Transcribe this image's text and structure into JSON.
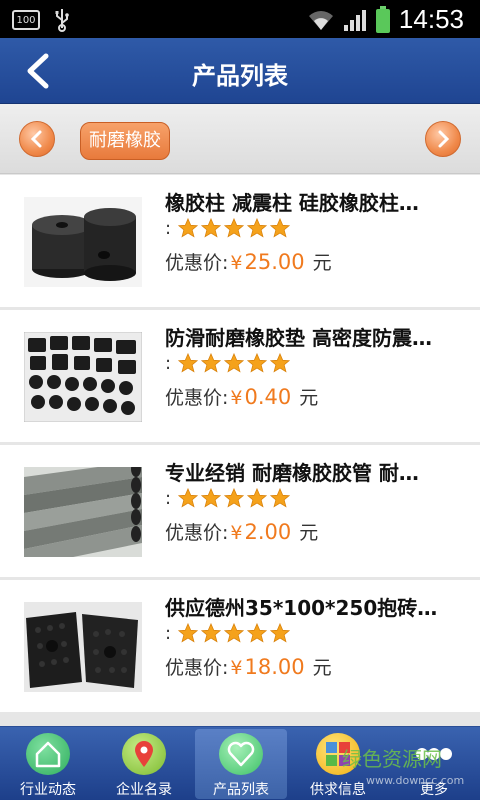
{
  "status_bar": {
    "battery_small": "100",
    "time": "14:53"
  },
  "header": {
    "title": "产品列表"
  },
  "category": {
    "active": "耐磨橡胶"
  },
  "products": [
    {
      "title": "橡胶柱 减震柱 硅胶橡胶柱…",
      "rating_prefix": ":",
      "stars": 5,
      "price_label": "优惠价:",
      "currency": "¥",
      "price": "25.00",
      "unit": "元"
    },
    {
      "title": "防滑耐磨橡胶垫 高密度防震…",
      "rating_prefix": ":",
      "stars": 5,
      "price_label": "优惠价:",
      "currency": "¥",
      "price": "0.40",
      "unit": "元"
    },
    {
      "title": "专业经销 耐磨橡胶胶管 耐…",
      "rating_prefix": ":",
      "stars": 5,
      "price_label": "优惠价:",
      "currency": "¥",
      "price": "2.00",
      "unit": "元"
    },
    {
      "title": "供应德州35*100*250抱砖…",
      "rating_prefix": ":",
      "stars": 5,
      "price_label": "优惠价:",
      "currency": "¥",
      "price": "18.00",
      "unit": "元"
    }
  ],
  "tabs": [
    {
      "label": "行业动态",
      "icon": "home-icon",
      "color": "#3dbb6a"
    },
    {
      "label": "企业名录",
      "icon": "map-pin-icon",
      "color": "#8cc63e"
    },
    {
      "label": "产品列表",
      "icon": "heart-icon",
      "color": "#5fd17a"
    },
    {
      "label": "供求信息",
      "icon": "puzzle-icon",
      "color": "#f5c020"
    },
    {
      "label": "更多",
      "icon": "more-icon",
      "color": "#ffffff"
    }
  ],
  "watermark": {
    "text": "绿色资源网",
    "url_text": "www.downcc.com"
  },
  "colors": {
    "header": "#2f5aa8",
    "accent": "#f07a1e",
    "star": "#f5a21b"
  }
}
